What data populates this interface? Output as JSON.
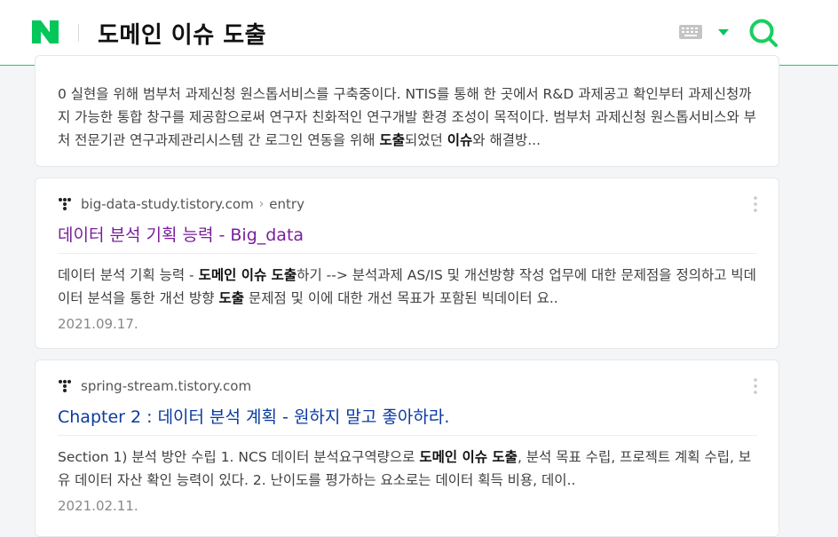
{
  "header": {
    "query": "도메인 이슈 도출",
    "logo_label": "N",
    "brand_color": "#03c75a",
    "accent_color": "#19ce60"
  },
  "results": [
    {
      "snippet_parts": [
        {
          "t": "0 실현을 위해 범부처 과제신청 원스톱서비스를 구축중이다. NTIS를 통해 한 곳에서 R&D 과제공고 확인부터 과제신청까지 가능한 통합 창구를 제공함으로써 연구자 친화적인 연구개발 환경 조성이 목적이다. 범부처 과제신청 원스톱서비스와 부처 전문기관 연구과제관리시스템 간 로그인 연동을 위해 ",
          "b": false
        },
        {
          "t": "도출",
          "b": true
        },
        {
          "t": "되었던 ",
          "b": false
        },
        {
          "t": "이슈",
          "b": true
        },
        {
          "t": "와 해결방...",
          "b": false
        }
      ]
    },
    {
      "site": "big-data-study.tistory.com",
      "path": "entry",
      "title": "데이터 분석 기획 능력 - Big_data",
      "snippet_parts": [
        {
          "t": "데이터 분석 기획 능력 - ",
          "b": false
        },
        {
          "t": "도메인 이슈 도출",
          "b": true
        },
        {
          "t": "하기 --> 분석과제 AS/IS 및 개선방향 작성 업무에 대한 문제점을 정의하고 빅데이터 분석을 통한 개선 방향 ",
          "b": false
        },
        {
          "t": "도출",
          "b": true
        },
        {
          "t": " 문제점 및 이에 대한 개선 목표가 포함된 빅데이터 요..",
          "b": false
        }
      ],
      "date": "2021.09.17."
    },
    {
      "site": "spring-stream.tistory.com",
      "title": "Chapter 2 : 데이터 분석 계획 - 원하지 말고 좋아하라.",
      "snippet_parts": [
        {
          "t": "Section 1) 분석 방안 수립 1. NCS 데이터 분석요구역량으로 ",
          "b": false
        },
        {
          "t": "도메인 이슈 도출",
          "b": true
        },
        {
          "t": ", 분석 목표 수립, 프로젝트 계획 수립, 보유 데이터 자산 확인 능력이 있다. 2. 난이도를 평가하는 요소로는 데이터 획득 비용, 데이..",
          "b": false
        }
      ],
      "date": "2021.02.11."
    }
  ]
}
